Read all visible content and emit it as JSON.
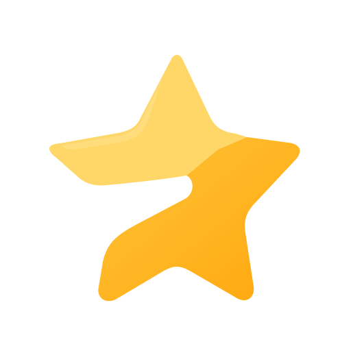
{
  "icon": {
    "name": "star-icon",
    "colors": {
      "background": "#ffffff",
      "light_upper": "#FFD768",
      "light_upper_highlight": "#FFE28C",
      "deep_lower_start": "#FFC43A",
      "deep_lower_end": "#FFA70D"
    }
  }
}
